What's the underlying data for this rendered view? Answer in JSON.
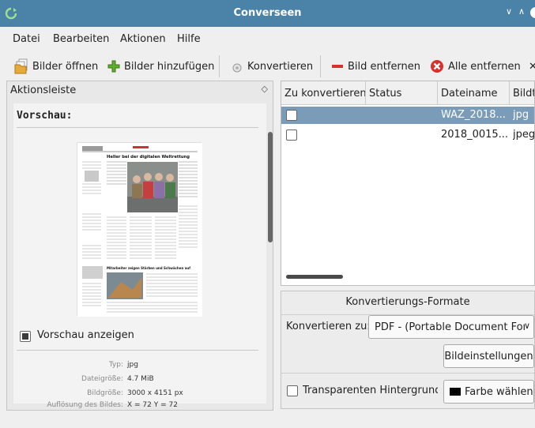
{
  "window": {
    "title": "Converseen"
  },
  "menu": [
    "Datei",
    "Bearbeiten",
    "Aktionen",
    "Hilfe"
  ],
  "toolbar": {
    "open": "Bilder öffnen",
    "add": "Bilder hinzufügen",
    "convert": "Konvertieren",
    "remove": "Bild entfernen",
    "remove_all": "Alle entfernen"
  },
  "actions_panel": {
    "title": "Aktionsleiste",
    "preview_heading": "Vorschau:",
    "show_preview_label": "Vorschau anzeigen",
    "show_preview_checked": true,
    "preview_image": {
      "header": "Heller bei der digitalen Weltrettung",
      "subhead": "Mitarbeiter zeigen Stärken und Schwächen auf"
    },
    "info": [
      {
        "key": "Typ:",
        "value": "jpg"
      },
      {
        "key": "Dateigröße:",
        "value": "4.7 MiB"
      },
      {
        "key": "Bildgröße:",
        "value": "3000 x 4151 px"
      },
      {
        "key": "Auflösung des Bildes:",
        "value": "X = 72 Y = 72"
      }
    ]
  },
  "table": {
    "columns": [
      "Zu konvertieren",
      "Status",
      "Dateiname",
      "Bildtyp"
    ],
    "rows": [
      {
        "checked": false,
        "status": "",
        "filename": "WAZ_2018...",
        "type": "jpg",
        "selected": true
      },
      {
        "checked": false,
        "status": "",
        "filename": "2018_0015...",
        "type": "jpeg",
        "selected": false
      }
    ]
  },
  "formats": {
    "title": "Konvertierungs-Formate",
    "convert_to_label": "Konvertieren zu:",
    "convert_to_value": "PDF - (Portable Document Format)",
    "image_settings_button": "Bildeinstellungen",
    "transparent_label": "Transparenten Hintergrund ersetzen",
    "transparent_checked": false,
    "choose_color_button": "Farbe wählen",
    "chosen_color": "#000000"
  },
  "colors": {
    "titlebar": "#4a82a8",
    "selection": "#7a9cb8"
  }
}
